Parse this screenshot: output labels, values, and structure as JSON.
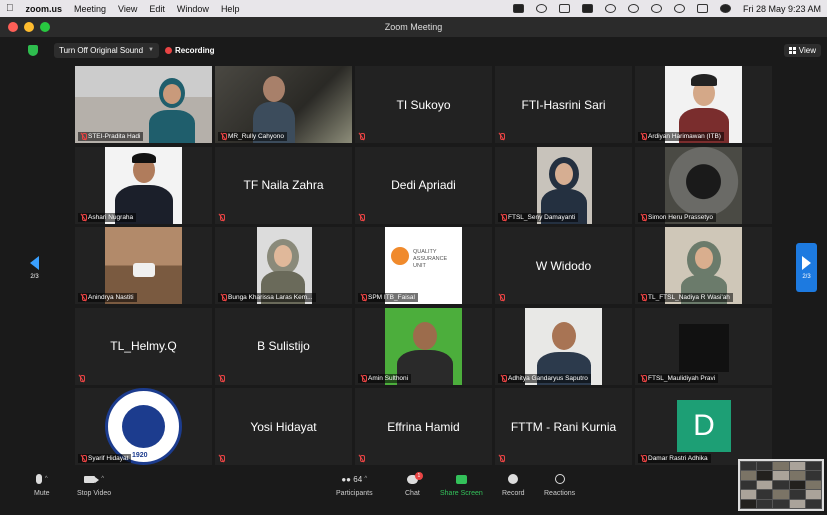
{
  "menubar": {
    "app": "zoom.us",
    "items": [
      "Meeting",
      "View",
      "Edit",
      "Window",
      "Help"
    ],
    "datetime": "Fri 28 May  9:23 AM"
  },
  "window": {
    "title": "Zoom Meeting"
  },
  "topbar": {
    "sound_button": "Turn Off Original Sound",
    "recording": "Recording",
    "view_button": "View"
  },
  "nav": {
    "page": "2/3"
  },
  "tiles": [
    {
      "name": "STEI-Pradita Hadi",
      "video": true
    },
    {
      "name": "MR_Rully Cahyono",
      "video": true
    },
    {
      "name": "TI Sukoyo",
      "video": false
    },
    {
      "name": "FTI-Hasrini Sari",
      "video": false
    },
    {
      "name": "Ardiyan Harimawan (ITB)",
      "video": true
    },
    {
      "name": "Ashari Nugraha",
      "video": true
    },
    {
      "name": "TF Naila Zahra",
      "video": false
    },
    {
      "name": "Dedi Apriadi",
      "video": false
    },
    {
      "name": "FTSL_Seny Damayanti",
      "video": true
    },
    {
      "name": "Simon Heru Prassetyo",
      "video": true
    },
    {
      "name": "Anindrya Nastiti",
      "video": true
    },
    {
      "name": "Bunga Kharissa Laras Kem...",
      "video": true
    },
    {
      "name": "SPM ITB_Faisal",
      "video": true
    },
    {
      "name": "W Widodo",
      "video": false
    },
    {
      "name": "TL_FTSL_Nadiya R Wasi'ah",
      "video": true
    },
    {
      "name": "TL_Helmy.Q",
      "video": false
    },
    {
      "name": "B Sulistijo",
      "video": false
    },
    {
      "name": "Amin Sulthoni",
      "video": true
    },
    {
      "name": "Adhitya Gandaryus Saputro",
      "video": true
    },
    {
      "name": "FTSL_Maulidiyah Pravi",
      "video": true
    },
    {
      "name": "Syarif Hidayat",
      "video": true
    },
    {
      "name": "Yosi Hidayat",
      "video": false
    },
    {
      "name": "Effrina Hamid",
      "video": false
    },
    {
      "name": "FTTM - Rani Kurnia",
      "video": false
    },
    {
      "name": "Damar Rastri Adhika",
      "video": true
    }
  ],
  "logos": {
    "qa": "QUALITY\nASSURANCE\nUNIT",
    "itb_ring": "INSTITUT TEKNOLOGI BANDUNG",
    "itb_year": "1920"
  },
  "avatar_letter": "D",
  "toolbar": {
    "mute": "Mute",
    "stop_video": "Stop Video",
    "participants": "Participants",
    "participants_count": "64",
    "chat": "Chat",
    "chat_badge": "1",
    "share_screen": "Share Screen",
    "record": "Record",
    "reactions": "Reactions"
  },
  "colors": {
    "accent": "#1d7ae0",
    "recording": "#e94444",
    "share": "#33c15a",
    "avatar": "#1d9f75"
  }
}
